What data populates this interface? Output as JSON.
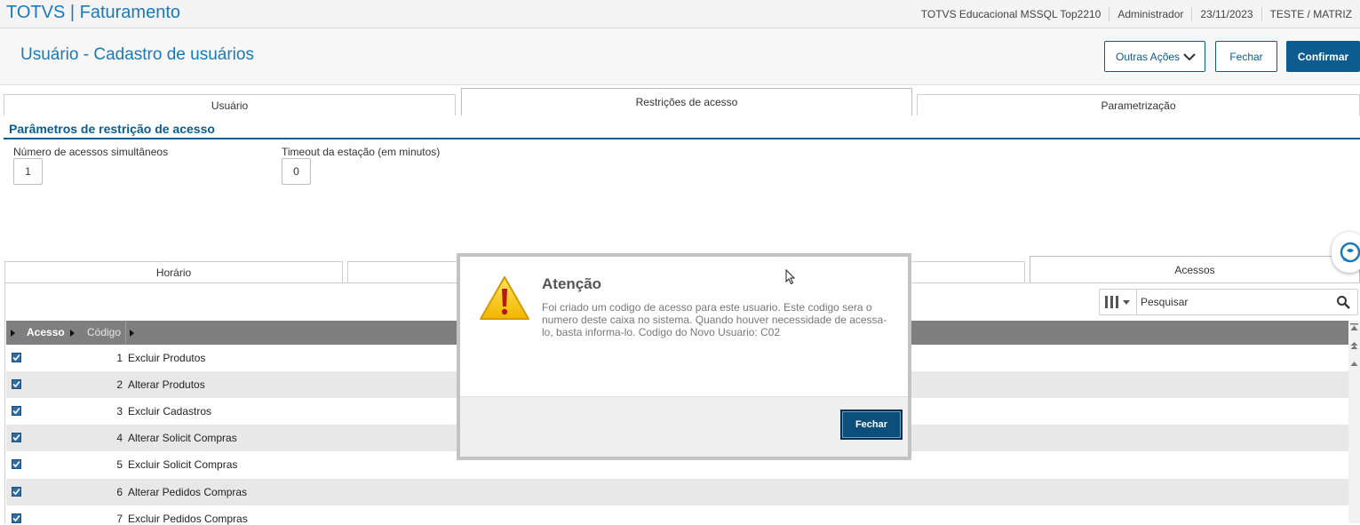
{
  "topbar": {
    "app_title": "TOTVS | Faturamento",
    "environment": "TOTVS Educacional MSSQL Top2210",
    "user": "Administrador",
    "date": "23/11/2023",
    "branch": "TESTE / MATRIZ"
  },
  "header": {
    "title": "Usuário - Cadastro de usuários",
    "more_actions_label": "Outras Ações",
    "close_label": "Fechar",
    "confirm_label": "Confirmar"
  },
  "tabs": [
    {
      "label": "Usuário"
    },
    {
      "label": "Restrições de acesso",
      "active": true
    },
    {
      "label": "Parametrização"
    }
  ],
  "section": {
    "title": "Parâmetros de restrição de acesso",
    "simultaneous_label": "Número de acessos simultâneos",
    "simultaneous_value": "1",
    "timeout_label": "Timeout da estação (em minutos)",
    "timeout_value": "0"
  },
  "subtabs": [
    {
      "label": "Horário"
    },
    {
      "label": ""
    },
    {
      "label": ""
    },
    {
      "label": "Acessos",
      "active": true
    }
  ],
  "grid": {
    "search_placeholder": "Pesquisar",
    "columns": [
      "Acesso",
      "Código"
    ],
    "rows": [
      {
        "checked": true,
        "num": "1",
        "desc": "Excluir Produtos"
      },
      {
        "checked": true,
        "num": "2",
        "desc": "Alterar Produtos"
      },
      {
        "checked": true,
        "num": "3",
        "desc": "Excluir Cadastros"
      },
      {
        "checked": true,
        "num": "4",
        "desc": "Alterar Solicit Compras"
      },
      {
        "checked": true,
        "num": "5",
        "desc": "Excluir Solicit Compras"
      },
      {
        "checked": true,
        "num": "6",
        "desc": "Alterar Pedidos Compras"
      },
      {
        "checked": true,
        "num": "7",
        "desc": "Excluir Pedidos Compras"
      }
    ]
  },
  "dialog": {
    "title": "Atenção",
    "message": "Foi criado um codigo de acesso para este usuario. Este codigo sera o numero deste caixa no sistema. Quando houver necessidade de acessa-lo, basta informa-lo. Codigo do Novo Usuario: C02",
    "close_label": "Fechar"
  },
  "colors": {
    "brand_blue": "#1b79b7",
    "primary_button": "#0c5c8f",
    "grid_header": "#7f7f7f",
    "warning_yellow": "#f5c400"
  }
}
